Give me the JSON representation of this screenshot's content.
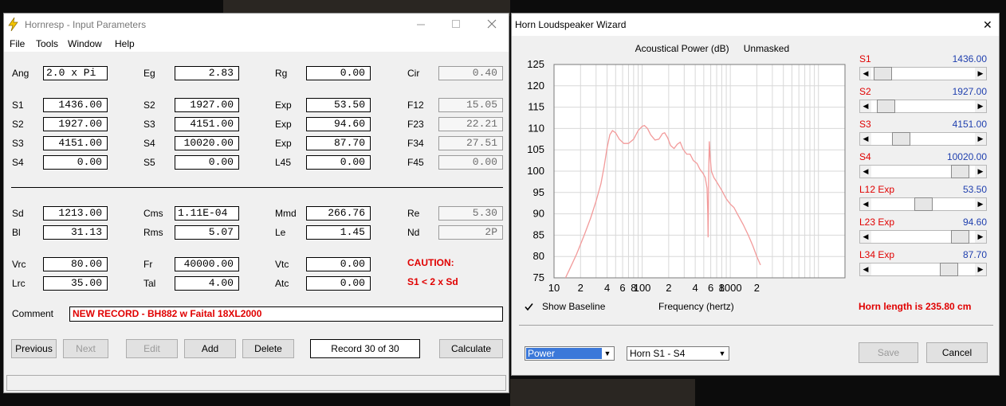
{
  "colors": {
    "accent_red": "#e00000",
    "value_blue": "#1f3fae",
    "curve": "#f29a9a",
    "select_blue": "#3b78d9"
  },
  "left_window": {
    "title": "Hornresp - Input Parameters",
    "menu": [
      "File",
      "Tools",
      "Window",
      "Help"
    ],
    "fields": [
      {
        "label": "Ang",
        "value": "2.0 x Pi"
      },
      {
        "label": "Eg",
        "value": "2.83"
      },
      {
        "label": "Rg",
        "value": "0.00"
      },
      {
        "label": "Cir",
        "value": "0.40"
      },
      {
        "label": "S1",
        "value": "1436.00"
      },
      {
        "label": "S2",
        "value": "1927.00"
      },
      {
        "label": "Exp",
        "value": "53.50"
      },
      {
        "label": "F12",
        "value": "15.05"
      },
      {
        "label": "S2",
        "value": "1927.00"
      },
      {
        "label": "S3",
        "value": "4151.00"
      },
      {
        "label": "Exp",
        "value": "94.60"
      },
      {
        "label": "F23",
        "value": "22.21"
      },
      {
        "label": "S3",
        "value": "4151.00"
      },
      {
        "label": "S4",
        "value": "10020.00"
      },
      {
        "label": "Exp",
        "value": "87.70"
      },
      {
        "label": "F34",
        "value": "27.51"
      },
      {
        "label": "S4",
        "value": "0.00"
      },
      {
        "label": "S5",
        "value": "0.00"
      },
      {
        "label": "L45",
        "value": "0.00"
      },
      {
        "label": "F45",
        "value": "0.00"
      },
      {
        "label": "Sd",
        "value": "1213.00"
      },
      {
        "label": "Cms",
        "value": "1.11E-04"
      },
      {
        "label": "Mmd",
        "value": "266.76"
      },
      {
        "label": "Re",
        "value": "5.30"
      },
      {
        "label": "Bl",
        "value": "31.13"
      },
      {
        "label": "Rms",
        "value": "5.07"
      },
      {
        "label": "Le",
        "value": "1.45"
      },
      {
        "label": "Nd",
        "value": "2P"
      },
      {
        "label": "Vrc",
        "value": "80.00"
      },
      {
        "label": "Fr",
        "value": "40000.00"
      },
      {
        "label": "Vtc",
        "value": "0.00"
      },
      {
        "label": "Lrc",
        "value": "35.00"
      },
      {
        "label": "Tal",
        "value": "4.00"
      },
      {
        "label": "Atc",
        "value": "0.00"
      }
    ],
    "caution_title": "CAUTION:",
    "caution_text": "S1 < 2 x Sd",
    "comment_label": "Comment",
    "comment": "NEW RECORD - BH882 w Faital 18XL2000",
    "buttons": {
      "previous": "Previous",
      "next": "Next",
      "edit": "Edit",
      "add": "Add",
      "delete": "Delete",
      "calculate": "Calculate"
    },
    "record": "Record 30 of 30"
  },
  "right_window": {
    "title": "Horn Loudspeaker Wizard",
    "close_glyph": "✕",
    "show_baseline": "Show Baseline",
    "frequency_label": "Frequency (hertz)",
    "horn_length": "Horn length is 235.80 cm",
    "power_select": "Power",
    "horn_select": "Horn S1 - S4",
    "save": "Save",
    "cancel": "Cancel",
    "sliders": [
      {
        "label": "S1",
        "value": "1436.00",
        "position": 0.03
      },
      {
        "label": "S2",
        "value": "1927.00",
        "position": 0.07
      },
      {
        "label": "S3",
        "value": "4151.00",
        "position": 0.24
      },
      {
        "label": "S4",
        "value": "10020.00",
        "position": 0.93
      },
      {
        "label": "L12  Exp",
        "value": "53.50",
        "position": 0.5
      },
      {
        "label": "L23  Exp",
        "value": "94.60",
        "position": 0.93
      },
      {
        "label": "L34  Exp",
        "value": "87.70",
        "position": 0.8
      }
    ]
  },
  "chart_data": {
    "type": "line",
    "title": "Acoustical Power (dB)",
    "subtitle": "Unmasked",
    "xlabel": "Frequency (hertz)",
    "ylabel": "",
    "x_scale": "log",
    "xlim": [
      10,
      20000
    ],
    "ylim": [
      75,
      125
    ],
    "x_tick_labels": [
      {
        "f": 10,
        "label": "10"
      },
      {
        "f": 20,
        "label": "2"
      },
      {
        "f": 40,
        "label": "4"
      },
      {
        "f": 60,
        "label": "6"
      },
      {
        "f": 80,
        "label": "8"
      },
      {
        "f": 100,
        "label": "100"
      },
      {
        "f": 200,
        "label": "2"
      },
      {
        "f": 400,
        "label": "4"
      },
      {
        "f": 600,
        "label": "6"
      },
      {
        "f": 800,
        "label": "8"
      },
      {
        "f": 1000,
        "label": "1000"
      },
      {
        "f": 2000,
        "label": "2"
      }
    ],
    "y_ticks": [
      75,
      80,
      85,
      90,
      95,
      100,
      105,
      110,
      115,
      120,
      125
    ],
    "grid": true,
    "series": [
      {
        "values": [
          [
            13.5,
            75
          ],
          [
            15,
            77
          ],
          [
            18,
            80.5
          ],
          [
            22,
            85
          ],
          [
            26,
            89
          ],
          [
            30,
            93
          ],
          [
            34,
            97
          ],
          [
            37,
            101
          ],
          [
            40,
            105.5
          ],
          [
            43,
            108.5
          ],
          [
            46,
            109.5
          ],
          [
            50,
            109
          ],
          [
            55,
            107.5
          ],
          [
            62,
            106.5
          ],
          [
            70,
            106.5
          ],
          [
            80,
            107.5
          ],
          [
            90,
            109.5
          ],
          [
            100,
            110.5
          ],
          [
            106,
            110.7
          ],
          [
            115,
            110
          ],
          [
            125,
            108.5
          ],
          [
            140,
            107.3
          ],
          [
            155,
            107.5
          ],
          [
            170,
            108.8
          ],
          [
            180,
            109
          ],
          [
            195,
            107.8
          ],
          [
            210,
            106
          ],
          [
            230,
            105.3
          ],
          [
            250,
            106.3
          ],
          [
            270,
            106.8
          ],
          [
            290,
            105.2
          ],
          [
            320,
            104
          ],
          [
            350,
            104
          ],
          [
            380,
            102.5
          ],
          [
            420,
            101.8
          ],
          [
            450,
            100.5
          ],
          [
            490,
            99.5
          ],
          [
            520,
            98.5
          ],
          [
            545,
            96
          ],
          [
            555,
            90
          ],
          [
            560,
            84.5
          ],
          [
            565,
            91
          ],
          [
            570,
            100
          ],
          [
            578,
            107
          ],
          [
            590,
            103.5
          ],
          [
            610,
            100
          ],
          [
            650,
            98.5
          ],
          [
            700,
            97.5
          ],
          [
            800,
            95.5
          ],
          [
            900,
            93.5
          ],
          [
            1000,
            92.3
          ],
          [
            1100,
            91.5
          ],
          [
            1200,
            90
          ],
          [
            1400,
            87.5
          ],
          [
            1600,
            85
          ],
          [
            1800,
            82.5
          ],
          [
            2000,
            80
          ],
          [
            2200,
            78
          ]
        ]
      }
    ]
  }
}
